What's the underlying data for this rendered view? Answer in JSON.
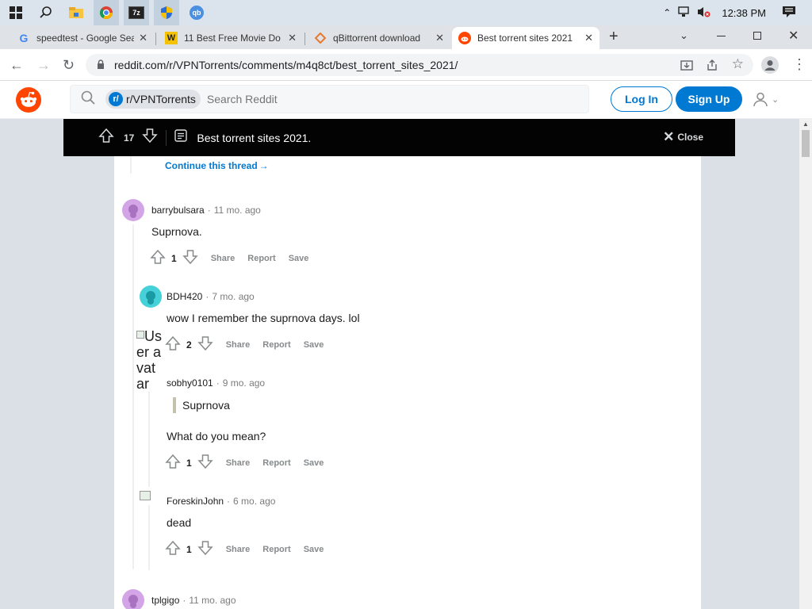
{
  "taskbar": {
    "time": "12:38 PM"
  },
  "tabs": [
    {
      "label": "speedtest - Google Sea",
      "favicon": "google-icon"
    },
    {
      "label": "11 Best Free Movie Do",
      "favicon": "w-site-icon"
    },
    {
      "label": "qBittorrent download",
      "favicon": "qbittorrent-site-icon"
    },
    {
      "label": "Best torrent sites 2021",
      "favicon": "reddit-icon"
    }
  ],
  "address": {
    "url": "reddit.com/r/VPNTorrents/comments/m4q8ct/best_torrent_sites_2021/"
  },
  "reddit_header": {
    "community_chip": "r/VPNTorrents",
    "search_placeholder": "Search Reddit",
    "login_label": "Log In",
    "signup_label": "Sign Up"
  },
  "post_bar": {
    "votes": "17",
    "title": "Best torrent sites 2021.",
    "close_label": "Close"
  },
  "continue_thread": "Continue this thread",
  "actions": {
    "share": "Share",
    "report": "Report",
    "save": "Save"
  },
  "broken_avatar_alt": "User avatar",
  "comments": [
    {
      "user": "barrybulsara",
      "time": "11 mo. ago",
      "text": "Suprnova.",
      "votes": "1",
      "avatar_color": "#d4a5e6"
    },
    {
      "user": "BDH420",
      "time": "7 mo. ago",
      "text": "wow I remember the suprnova days. lol",
      "votes": "2",
      "avatar_color": "#46d1d8"
    },
    {
      "user": "sobhy0101",
      "time": "9 mo. ago",
      "quote": "Suprnova",
      "text": "What do you mean?",
      "votes": "1"
    },
    {
      "user": "ForeskinJohn",
      "time": "6 mo. ago",
      "text": "dead",
      "votes": "1"
    },
    {
      "user": "tplgigo",
      "time": "11 mo. ago",
      "avatar_color": "#d4a5e6"
    }
  ],
  "colors": {
    "reddit_orange": "#ff4500",
    "reddit_blue": "#0079d3",
    "link_blue": "#0079d3"
  }
}
